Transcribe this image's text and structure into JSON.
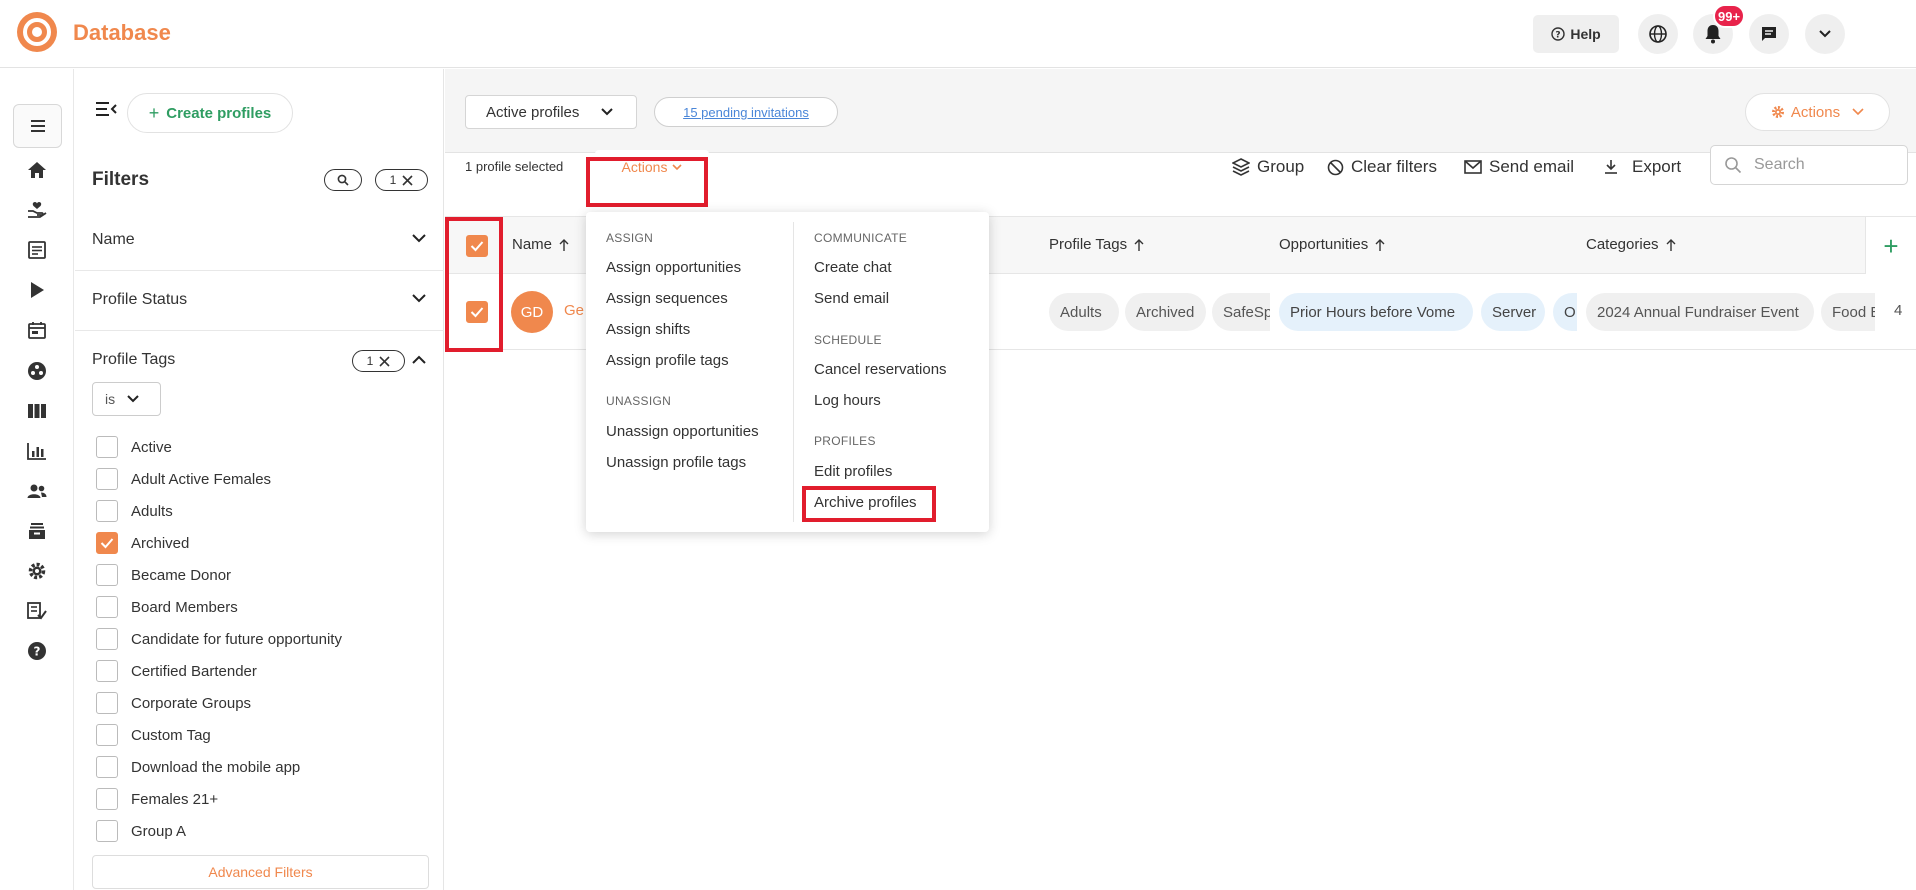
{
  "app": {
    "brand": "Database"
  },
  "header": {
    "help_label": "Help",
    "notification_count": "99+"
  },
  "filters_panel": {
    "create_label": "Create profiles",
    "title": "Filters",
    "filter_count": "1",
    "sections": [
      "Name",
      "Profile Status"
    ],
    "profile_tags": {
      "label": "Profile Tags",
      "count": "1",
      "operator": "is",
      "options": [
        {
          "label": "Active",
          "checked": false
        },
        {
          "label": "Adult Active Females",
          "checked": false
        },
        {
          "label": "Adults",
          "checked": false
        },
        {
          "label": "Archived",
          "checked": true
        },
        {
          "label": "Became Donor",
          "checked": false
        },
        {
          "label": "Board Members",
          "checked": false
        },
        {
          "label": "Candidate for future opportunity",
          "checked": false
        },
        {
          "label": "Certified Bartender",
          "checked": false
        },
        {
          "label": "Corporate Groups",
          "checked": false
        },
        {
          "label": "Custom Tag",
          "checked": false
        },
        {
          "label": "Download the mobile app",
          "checked": false
        },
        {
          "label": "Females 21+",
          "checked": false
        },
        {
          "label": "Group A",
          "checked": false
        }
      ]
    },
    "advanced_label": "Advanced Filters"
  },
  "toolbar": {
    "view_select": "Active profiles",
    "pending_link": "15 pending invitations",
    "actions_label": "Actions",
    "selected_text": "1 profile selected",
    "bulk_actions_label": "Actions",
    "group_label": "Group",
    "clear_filters_label": "Clear filters",
    "send_email_label": "Send email",
    "export_label": "Export",
    "search_placeholder": "Search"
  },
  "table": {
    "columns": {
      "name": "Name",
      "tags": "Profile Tags",
      "opportunities": "Opportunities",
      "categories": "Categories"
    },
    "row": {
      "initials": "GD",
      "name_partial": "Ge",
      "tags": [
        "Adults",
        "Archived",
        "SafeSp"
      ],
      "opportunities": [
        "Prior Hours before Vome",
        "Server",
        "O"
      ],
      "categories": [
        "2024 Annual Fundraiser Event",
        "Food B"
      ],
      "overflow_count": "4"
    }
  },
  "actions_menu": {
    "assign_header": "ASSIGN",
    "assign_items": [
      "Assign opportunities",
      "Assign sequences",
      "Assign shifts",
      "Assign profile tags"
    ],
    "unassign_header": "UNASSIGN",
    "unassign_items": [
      "Unassign opportunities",
      "Unassign profile tags"
    ],
    "communicate_header": "COMMUNICATE",
    "communicate_items": [
      "Create chat",
      "Send email"
    ],
    "schedule_header": "SCHEDULE",
    "schedule_items": [
      "Cancel reservations",
      "Log hours"
    ],
    "profiles_header": "PROFILES",
    "profiles_items": [
      "Edit profiles",
      "Archive profiles"
    ]
  },
  "colors": {
    "accent": "#f0884d",
    "green": "#2f9d62",
    "highlight": "#e11d2d",
    "badge": "#e8234b"
  }
}
